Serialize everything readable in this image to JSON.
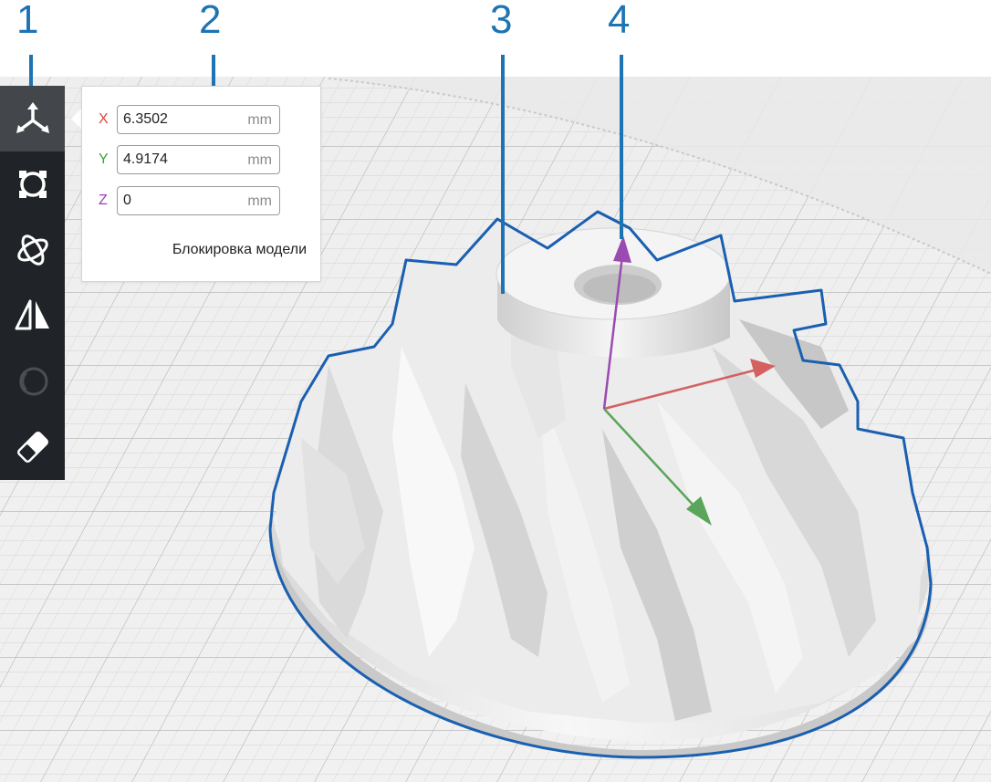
{
  "callouts": [
    "1",
    "2",
    "3",
    "4"
  ],
  "toolbar": {
    "tools": [
      {
        "icon": "move-icon",
        "active": true
      },
      {
        "icon": "scale-icon",
        "active": false
      },
      {
        "icon": "rotate-icon",
        "active": false
      },
      {
        "icon": "mirror-icon",
        "active": false
      },
      {
        "icon": "per-model-settings-icon",
        "active": false,
        "disabled": true
      },
      {
        "icon": "support-blocker-icon",
        "active": false
      }
    ]
  },
  "move_panel": {
    "x": {
      "label": "X",
      "value": "6.3502",
      "unit": "mm",
      "color": "#e0443a"
    },
    "y": {
      "label": "Y",
      "value": "4.9174",
      "unit": "mm",
      "color": "#3ca03c"
    },
    "z": {
      "label": "Z",
      "value": "0",
      "unit": "mm",
      "color": "#a33ab8"
    },
    "lock_model_label": "Блокировка модели"
  },
  "colors": {
    "callout": "#1e73b3",
    "toolbar_bg": "#202428",
    "selection_outline": "#1a5fb0",
    "axis_x": "#d46060",
    "axis_y": "#5aa55a",
    "axis_z": "#9a4ab0"
  }
}
